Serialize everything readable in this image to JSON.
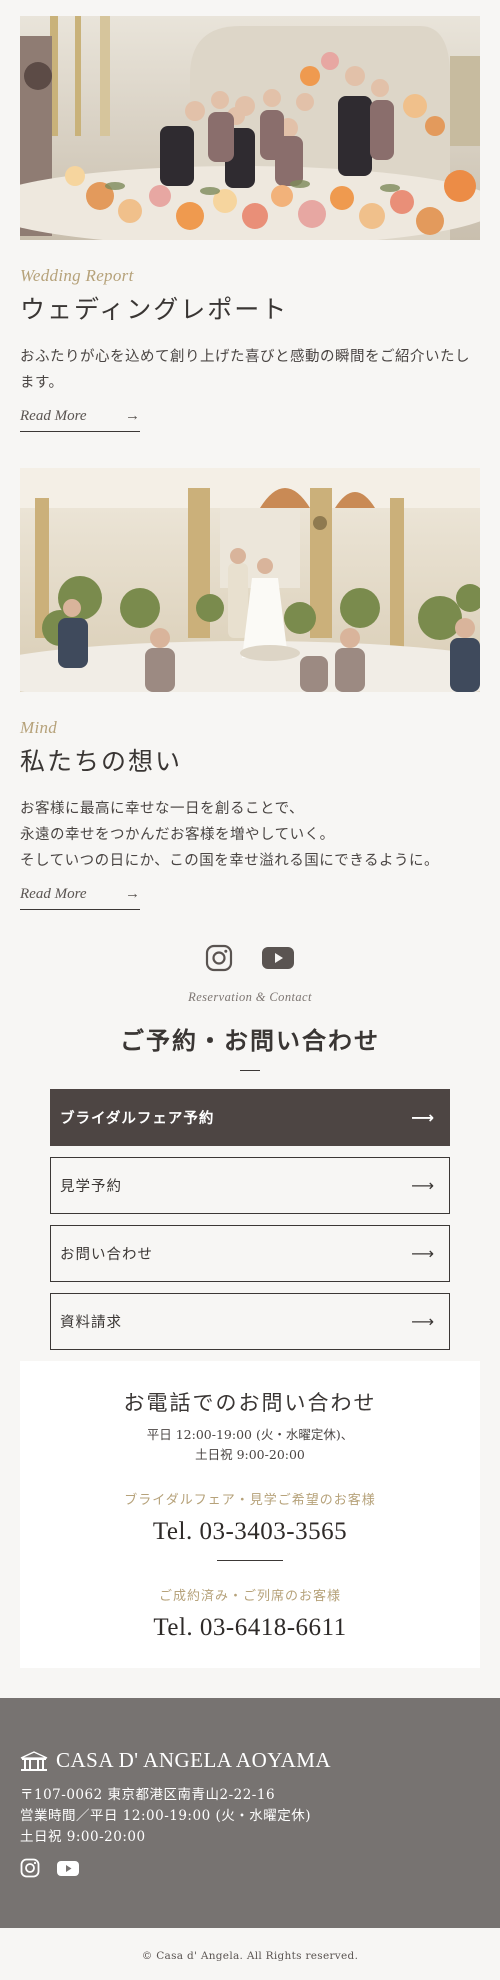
{
  "wedding_report": {
    "label": "Wedding Report",
    "heading": "ウェディングレポート",
    "text": "おふたりが心を込めて創り上げた喜びと感動の瞬間をご紹介いたします。",
    "read_more": "Read More",
    "arrow": "→"
  },
  "mind": {
    "label": "Mind",
    "heading": "私たちの想い",
    "lines": [
      "お客様に最高に幸せな一日を創ることで、",
      "永遠の幸せをつかんだお客様を増やしていく。",
      "そしていつの日にか、この国を幸せ溢れる国にできるように。"
    ],
    "read_more": "Read More",
    "arrow": "→"
  },
  "social_icons": [
    "instagram-icon",
    "youtube-icon"
  ],
  "reservation": {
    "label": "Reservation & Contact",
    "heading": "ご予約・お問い合わせ",
    "buttons": [
      {
        "label": "ブライダルフェア予約",
        "arrow": "⟶"
      },
      {
        "label": "見学予約",
        "arrow": "⟶"
      },
      {
        "label": "お問い合わせ",
        "arrow": "⟶"
      },
      {
        "label": "資料請求",
        "arrow": "⟶"
      }
    ]
  },
  "phone": {
    "title": "お電話でのお問い合わせ",
    "hours_line1": "平日 12:00-19:00 (火・水曜定休)、",
    "hours_line2": "土日祝 9:00-20:00",
    "sub1": "ブライダルフェア・見学ご希望のお客様",
    "tel1": "Tel. 03-3403-3565",
    "sub2": "ご成約済み・ご列席のお客様",
    "tel2": "Tel. 03-6418-6611"
  },
  "footer": {
    "brand": "CASA D' ANGELA AOYAMA",
    "address": "〒107-0062 東京都港区南青山2-22-16",
    "hours": "営業時間／平日 12:00-19:00 (火・水曜定休)",
    "weekend": "土日祝 9:00-20:00",
    "copyright": "© Casa d' Angela. All Rights reserved."
  },
  "colors": {
    "accent_gold": "#b6a27a",
    "primary_button": "#4d4543",
    "footer_bg": "#777371",
    "page_bg": "#f7f6f4"
  }
}
